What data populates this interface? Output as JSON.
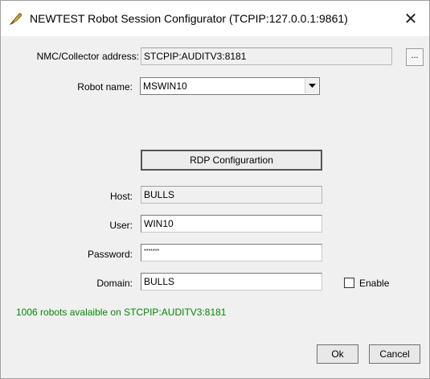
{
  "window": {
    "title": "NEWTEST Robot Session Configurator (TCPIP:127.0.0.1:9861)",
    "close_glyph": "✕",
    "icon": "feather-icon"
  },
  "collector": {
    "label": "NMC/Collector address:",
    "value": "STCPIP:AUDITV3:8181",
    "browse_label": "..."
  },
  "robot": {
    "label": "Robot name:",
    "value": "MSWIN10",
    "arrow_icon": "chevron-down-icon"
  },
  "rdp": {
    "button_label": "RDP Configurartion"
  },
  "host": {
    "label": "Host:",
    "value": "BULLS"
  },
  "user": {
    "label": "User:",
    "value": "WIN10"
  },
  "password": {
    "label": "Password:",
    "value": "*******"
  },
  "domain": {
    "label": "Domain:",
    "value": "BULLS"
  },
  "enable": {
    "label": "Enable",
    "checked": false
  },
  "status": {
    "text": "1006 robots avalaible on STCPIP:AUDITV3:8181",
    "color": "#008a00"
  },
  "footer": {
    "ok_label": "Ok",
    "cancel_label": "Cancel"
  }
}
